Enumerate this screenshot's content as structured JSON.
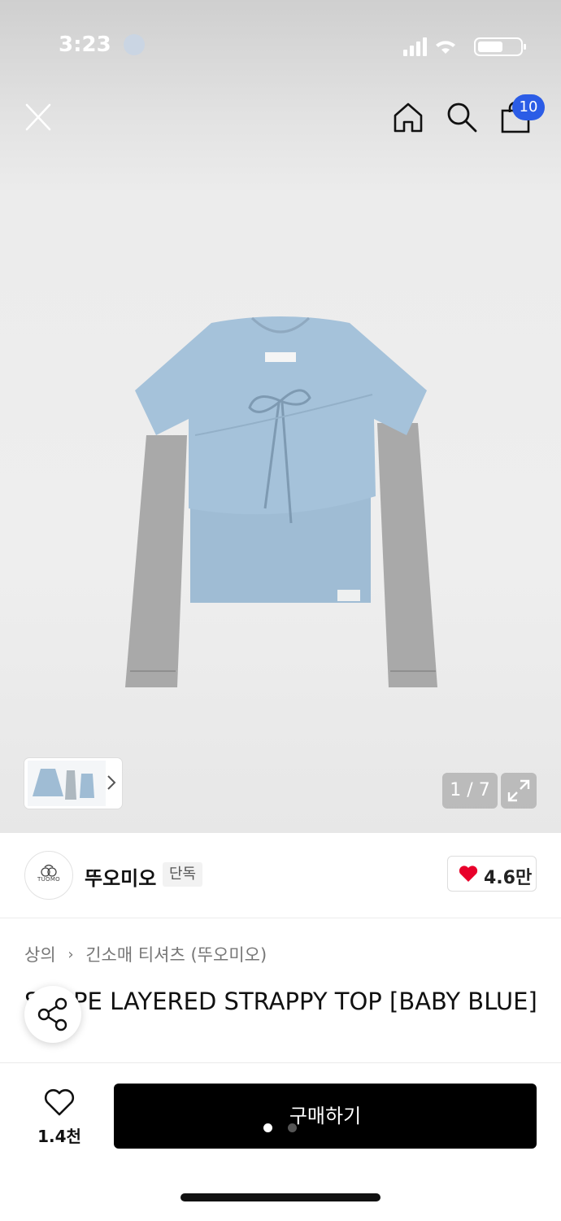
{
  "status_bar": {
    "time": "3:23"
  },
  "top_nav": {
    "close_icon": "close-icon",
    "home_icon": "home-icon",
    "search_icon": "search-icon",
    "cart_icon": "shopping-bag-icon",
    "cart_count": "10"
  },
  "gallery": {
    "pager": "1 / 7",
    "expand_icon": "expand-icon",
    "thumbnail_more_icon": "chevron-right-icon"
  },
  "brand": {
    "logo_text": "TUOMO",
    "name": "뚜오미오",
    "tag": "단독",
    "likes": "4.6만"
  },
  "breadcrumb": {
    "category": "상의",
    "subcategory": "긴소매 티셔츠 (뚜오미오)"
  },
  "product": {
    "title": "SHAPE LAYERED STRAPPY TOP [BABY BLUE]",
    "share_icon": "share-icon"
  },
  "bottom_bar": {
    "wish_count": "1.4천",
    "buy_label": "구매하기"
  },
  "colors": {
    "accent_badge": "#2b5ce6",
    "heart": "#e8002a",
    "buy_button": "#000000"
  }
}
